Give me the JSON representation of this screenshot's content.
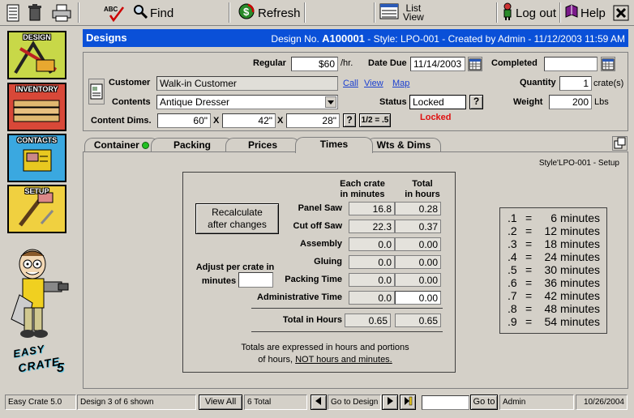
{
  "toolbar": {
    "find_label": "Find",
    "refresh_label": "Refresh",
    "list_view_line1": "List",
    "list_view_line2": "View",
    "logout_label": "Log out",
    "help_label": "Help"
  },
  "nav": {
    "design": "DESIGN",
    "inventory": "INVENTORY",
    "contacts": "CONTACTS",
    "setup": "SETUP"
  },
  "logo": {
    "line1": "EASY",
    "line2": "CRATE",
    "version": "5"
  },
  "titlebar": {
    "title": "Designs",
    "design_no_label": "Design No.",
    "design_no": "A100001",
    "info": "- Style: LPO-001 - Created by Admin  -  11/12/2003  11:59 AM"
  },
  "form": {
    "regular_label": "Regular",
    "regular_value": "$60",
    "regular_unit": "/hr.",
    "date_due_label": "Date Due",
    "date_due_value": "11/14/2003",
    "completed_label": "Completed",
    "completed_value": "",
    "customer_label": "Customer",
    "customer_value": "Walk-in Customer",
    "link_call": "Call",
    "link_view": "View",
    "link_map": "Map",
    "quantity_label": "Quantity",
    "quantity_value": "1",
    "quantity_unit": "crate(s)",
    "contents_label": "Contents",
    "contents_value": "Antique Dresser",
    "status_label": "Status",
    "status_value": "Locked",
    "status_help": "?",
    "status_notice": "Locked",
    "weight_label": "Weight",
    "weight_value": "200",
    "weight_unit": "Lbs",
    "dims_label": "Content Dims.",
    "dim1": "60\"",
    "dim2": "42\"",
    "dim3": "28\"",
    "x_sep": "X",
    "dims_help": "?",
    "half_button": "1/2 = .5"
  },
  "tabs": [
    "Container",
    "Packing",
    "Prices",
    "Times",
    "Wts & Dims"
  ],
  "tabs_active": "Times",
  "content": {
    "style_info": "Style'LPO-001  -  Setup",
    "col_each_line1": "Each crate",
    "col_each_line2": "in minutes",
    "col_total_line1": "Total",
    "col_total_line2": "in hours",
    "recalc_line1": "Recalculate",
    "recalc_line2": "after changes",
    "adjust_line1": "Adjust per crate in",
    "adjust_line2": "minutes",
    "adjust_value": "",
    "rows": [
      {
        "label": "Panel Saw",
        "each": "16.8",
        "total": "0.28"
      },
      {
        "label": "Cut off Saw",
        "each": "22.3",
        "total": "0.37"
      },
      {
        "label": "Assembly",
        "each": "0.0",
        "total": "0.00"
      },
      {
        "label": "Gluing",
        "each": "0.0",
        "total": "0.00"
      },
      {
        "label": "Packing Time",
        "each": "0.0",
        "total": "0.00"
      },
      {
        "label": "Administrative Time",
        "each": "0.0",
        "total": "0.00"
      }
    ],
    "total_label": "Total in Hours",
    "total_each": "0.65",
    "total_total": "0.65",
    "note_line1": "Totals are expressed in hours and portions",
    "note_line2_prefix": "of hours, ",
    "note_line2_emph": "NOT hours and minutes."
  },
  "lookup": [
    {
      "frac": ".1",
      "eq": "=",
      "min": "6 minutes"
    },
    {
      "frac": ".2",
      "eq": "=",
      "min": "12 minutes"
    },
    {
      "frac": ".3",
      "eq": "=",
      "min": "18 minutes"
    },
    {
      "frac": ".4",
      "eq": "=",
      "min": "24 minutes"
    },
    {
      "frac": ".5",
      "eq": "=",
      "min": "30 minutes"
    },
    {
      "frac": ".6",
      "eq": "=",
      "min": "36 minutes"
    },
    {
      "frac": ".7",
      "eq": "=",
      "min": "42 minutes"
    },
    {
      "frac": ".8",
      "eq": "=",
      "min": "48 minutes"
    },
    {
      "frac": ".9",
      "eq": "=",
      "min": "54 minutes"
    }
  ],
  "statusbar": {
    "app": "Easy Crate 5.0",
    "record": "Design 3 of 6 shown",
    "view_all": "View All",
    "total": "6 Total",
    "goto_design": "Go to Design",
    "goto_value": "",
    "goto_button": "Go to",
    "user": "Admin",
    "date": "10/26/2004"
  }
}
